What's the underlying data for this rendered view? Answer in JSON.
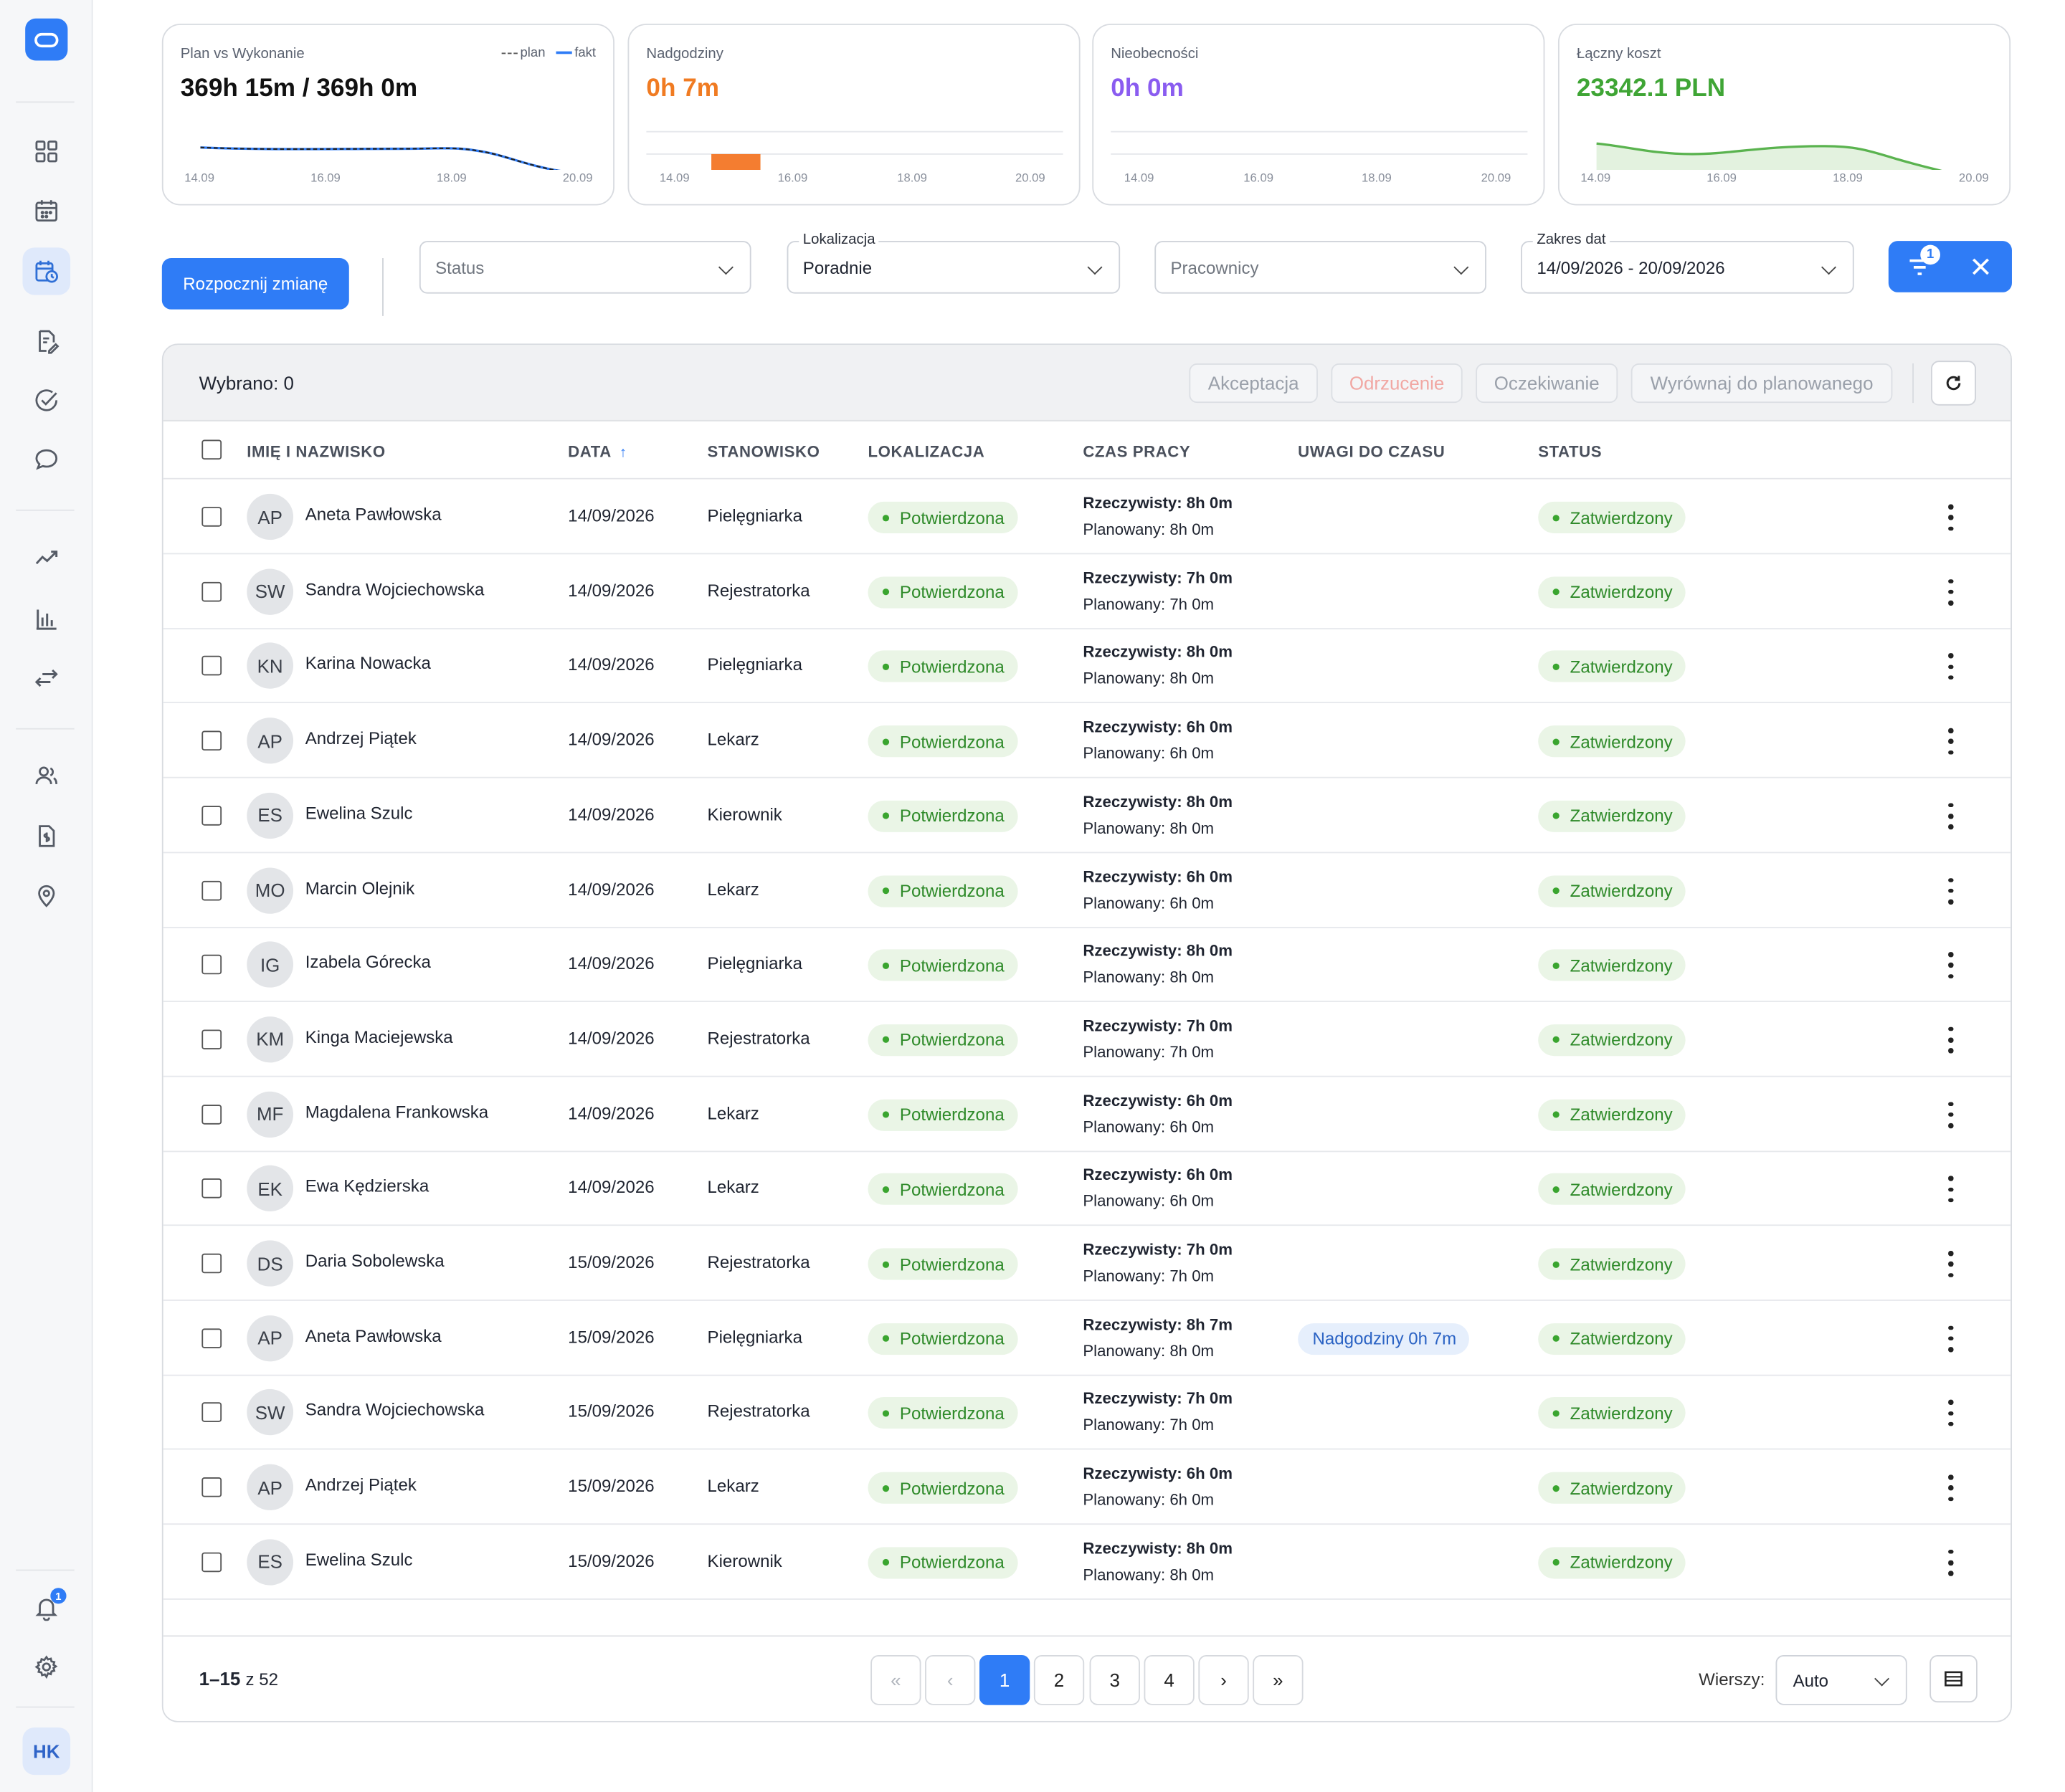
{
  "cards": [
    {
      "title": "Plan vs Wykonanie",
      "value": "369h 15m / 369h 0m",
      "value_color": "#111111",
      "legend": {
        "plan": "plan",
        "fakt": "fakt"
      },
      "ticks": [
        "14.09",
        "16.09",
        "18.09",
        "20.09"
      ]
    },
    {
      "title": "Nadgodziny",
      "value": "0h 7m",
      "value_color": "#f07b22",
      "ticks": [
        "14.09",
        "16.09",
        "18.09",
        "20.09"
      ]
    },
    {
      "title": "Nieobecności",
      "value": "0h 0m",
      "value_color": "#8a5cf0",
      "ticks": [
        "14.09",
        "16.09",
        "18.09",
        "20.09"
      ]
    },
    {
      "title": "Łączny koszt",
      "value": "23342.1 PLN",
      "value_color": "#3fa535",
      "ticks": [
        "14.09",
        "16.09",
        "18.09",
        "20.09"
      ]
    }
  ],
  "toolbar": {
    "start_shift_label": "Rozpocznij zmianę",
    "status": {
      "placeholder": "Status"
    },
    "location": {
      "label": "Lokalizacja",
      "value": "Poradnie"
    },
    "employees": {
      "placeholder": "Pracownicy"
    },
    "date_range": {
      "label": "Zakres dat",
      "value": "14/09/2026 - 20/09/2026"
    },
    "filter_count": "1"
  },
  "table": {
    "selected": "Wybrano: 0",
    "actions": {
      "accept": "Akceptacja",
      "reject": "Odrzucenie",
      "wait": "Oczekiwanie",
      "align": "Wyrównaj do planowanego"
    },
    "headers": {
      "name": "IMIĘ I NAZWISKO",
      "date": "DATA",
      "position": "STANOWISKO",
      "location": "LOKALIZACJA",
      "worktime": "CZAS PRACY",
      "notes": "UWAGI DO CZASU",
      "status": "STATUS"
    },
    "rows": [
      {
        "initials": "AP",
        "name": "Aneta Pawłowska",
        "date": "14/09/2026",
        "position": "Pielęgniarka",
        "location": "Potwierdzona",
        "actual": "Rzeczywisty: 8h 0m",
        "planned": "Planowany: 8h 0m",
        "note": "",
        "status": "Zatwierdzony"
      },
      {
        "initials": "SW",
        "name": "Sandra Wojciechowska",
        "date": "14/09/2026",
        "position": "Rejestratorka",
        "location": "Potwierdzona",
        "actual": "Rzeczywisty: 7h 0m",
        "planned": "Planowany: 7h 0m",
        "note": "",
        "status": "Zatwierdzony"
      },
      {
        "initials": "KN",
        "name": "Karina Nowacka",
        "date": "14/09/2026",
        "position": "Pielęgniarka",
        "location": "Potwierdzona",
        "actual": "Rzeczywisty: 8h 0m",
        "planned": "Planowany: 8h 0m",
        "note": "",
        "status": "Zatwierdzony"
      },
      {
        "initials": "AP",
        "name": "Andrzej Piątek",
        "date": "14/09/2026",
        "position": "Lekarz",
        "location": "Potwierdzona",
        "actual": "Rzeczywisty: 6h 0m",
        "planned": "Planowany: 6h 0m",
        "note": "",
        "status": "Zatwierdzony"
      },
      {
        "initials": "ES",
        "name": "Ewelina Szulc",
        "date": "14/09/2026",
        "position": "Kierownik",
        "location": "Potwierdzona",
        "actual": "Rzeczywisty: 8h 0m",
        "planned": "Planowany: 8h 0m",
        "note": "",
        "status": "Zatwierdzony"
      },
      {
        "initials": "MO",
        "name": "Marcin Olejnik",
        "date": "14/09/2026",
        "position": "Lekarz",
        "location": "Potwierdzona",
        "actual": "Rzeczywisty: 6h 0m",
        "planned": "Planowany: 6h 0m",
        "note": "",
        "status": "Zatwierdzony"
      },
      {
        "initials": "IG",
        "name": "Izabela Górecka",
        "date": "14/09/2026",
        "position": "Pielęgniarka",
        "location": "Potwierdzona",
        "actual": "Rzeczywisty: 8h 0m",
        "planned": "Planowany: 8h 0m",
        "note": "",
        "status": "Zatwierdzony"
      },
      {
        "initials": "KM",
        "name": "Kinga Maciejewska",
        "date": "14/09/2026",
        "position": "Rejestratorka",
        "location": "Potwierdzona",
        "actual": "Rzeczywisty: 7h 0m",
        "planned": "Planowany: 7h 0m",
        "note": "",
        "status": "Zatwierdzony"
      },
      {
        "initials": "MF",
        "name": "Magdalena Frankowska",
        "date": "14/09/2026",
        "position": "Lekarz",
        "location": "Potwierdzona",
        "actual": "Rzeczywisty: 6h 0m",
        "planned": "Planowany: 6h 0m",
        "note": "",
        "status": "Zatwierdzony"
      },
      {
        "initials": "EK",
        "name": "Ewa Kędzierska",
        "date": "14/09/2026",
        "position": "Lekarz",
        "location": "Potwierdzona",
        "actual": "Rzeczywisty: 6h 0m",
        "planned": "Planowany: 6h 0m",
        "note": "",
        "status": "Zatwierdzony"
      },
      {
        "initials": "DS",
        "name": "Daria Sobolewska",
        "date": "15/09/2026",
        "position": "Rejestratorka",
        "location": "Potwierdzona",
        "actual": "Rzeczywisty: 7h 0m",
        "planned": "Planowany: 7h 0m",
        "note": "",
        "status": "Zatwierdzony"
      },
      {
        "initials": "AP",
        "name": "Aneta Pawłowska",
        "date": "15/09/2026",
        "position": "Pielęgniarka",
        "location": "Potwierdzona",
        "actual": "Rzeczywisty: 8h 7m",
        "planned": "Planowany: 8h 0m",
        "note": "Nadgodziny 0h 7m",
        "status": "Zatwierdzony"
      },
      {
        "initials": "SW",
        "name": "Sandra Wojciechowska",
        "date": "15/09/2026",
        "position": "Rejestratorka",
        "location": "Potwierdzona",
        "actual": "Rzeczywisty: 7h 0m",
        "planned": "Planowany: 7h 0m",
        "note": "",
        "status": "Zatwierdzony"
      },
      {
        "initials": "AP",
        "name": "Andrzej Piątek",
        "date": "15/09/2026",
        "position": "Lekarz",
        "location": "Potwierdzona",
        "actual": "Rzeczywisty: 6h 0m",
        "planned": "Planowany: 6h 0m",
        "note": "",
        "status": "Zatwierdzony"
      },
      {
        "initials": "ES",
        "name": "Ewelina Szulc",
        "date": "15/09/2026",
        "position": "Kierownik",
        "location": "Potwierdzona",
        "actual": "Rzeczywisty: 8h 0m",
        "planned": "Planowany: 8h 0m",
        "note": "",
        "status": "Zatwierdzony"
      }
    ]
  },
  "pagination": {
    "range": "1–15",
    "of": "z 52",
    "pages": [
      "1",
      "2",
      "3",
      "4"
    ],
    "current": "1",
    "rows_label": "Wierszy:",
    "rows_value": "Auto"
  },
  "sidebar": {
    "notifications": "1",
    "user_initials": "HK"
  },
  "colors": {
    "accent": "#2f7cf6",
    "success": "#3fa535",
    "overtime": "#f07b22",
    "absence": "#8a5cf0"
  }
}
